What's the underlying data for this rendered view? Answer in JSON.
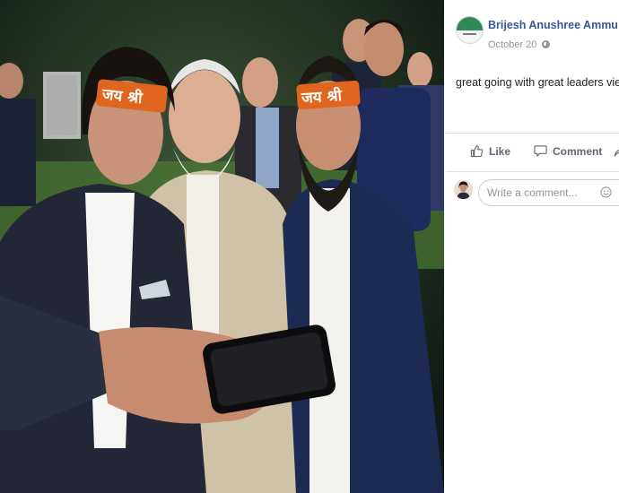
{
  "photo": {
    "headband_text": "जय श्री",
    "headband_color": "#e0661f"
  },
  "post": {
    "author": "Brijesh Anushree Ammu",
    "date": "October 20",
    "text": "great going with great leaders views.",
    "link_color": "#385898"
  },
  "actions": {
    "like_label": "Like",
    "comment_label": "Comment"
  },
  "comment_box": {
    "placeholder": "Write a comment..."
  },
  "icons": [
    "globe-icon",
    "like-icon",
    "comment-icon",
    "share-icon",
    "emoji-icon"
  ]
}
